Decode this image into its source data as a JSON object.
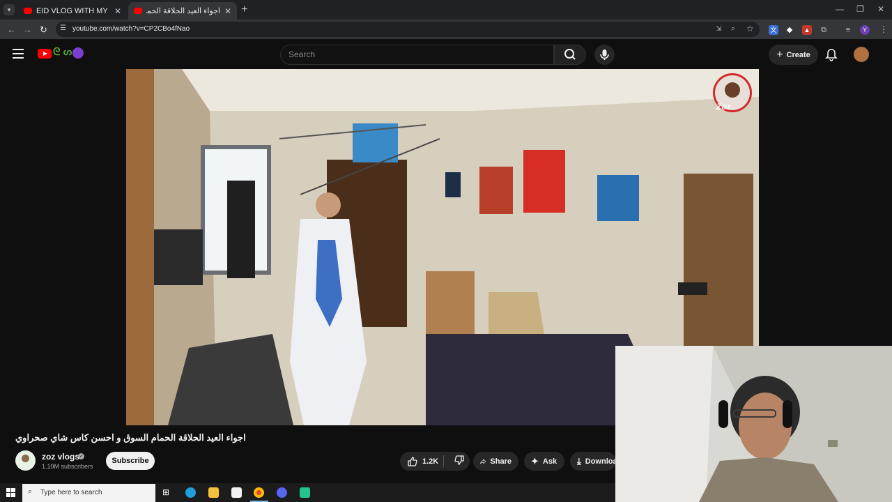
{
  "browser": {
    "tabs": [
      {
        "title": "EID VLOG WITH MY FAMILY I 🥹",
        "active": false
      },
      {
        "title": "اجواء العيد الحلاقة الحمام الس...",
        "active": true
      }
    ],
    "url": "youtube.com/watch?v=CP2CBo4fNao",
    "profile_initial": "Y"
  },
  "youtube": {
    "search_placeholder": "Search",
    "create_label": "Create",
    "video_title": "اجواء العيد الحلاقة الحمام السوق و احسن كاس شاي صحراوي",
    "channel": {
      "name": "zoz vlogs",
      "subscribers": "1.19M subscribers",
      "subscribe_label": "Subscribe"
    },
    "actions": {
      "likes": "1.2K",
      "share_label": "Share",
      "ask_label": "Ask",
      "download_label": "Download"
    },
    "watermark": "Zoz"
  },
  "taskbar": {
    "search_placeholder": "Type here to search",
    "pinned": [
      "task-view-icon",
      "edge-icon",
      "file-explorer-icon",
      "store-icon",
      "chrome-icon",
      "discord-icon",
      "app-icon"
    ]
  },
  "colors": {
    "youtube_red": "#ff0000",
    "background": "#0f0f0f",
    "chip": "#272727"
  }
}
